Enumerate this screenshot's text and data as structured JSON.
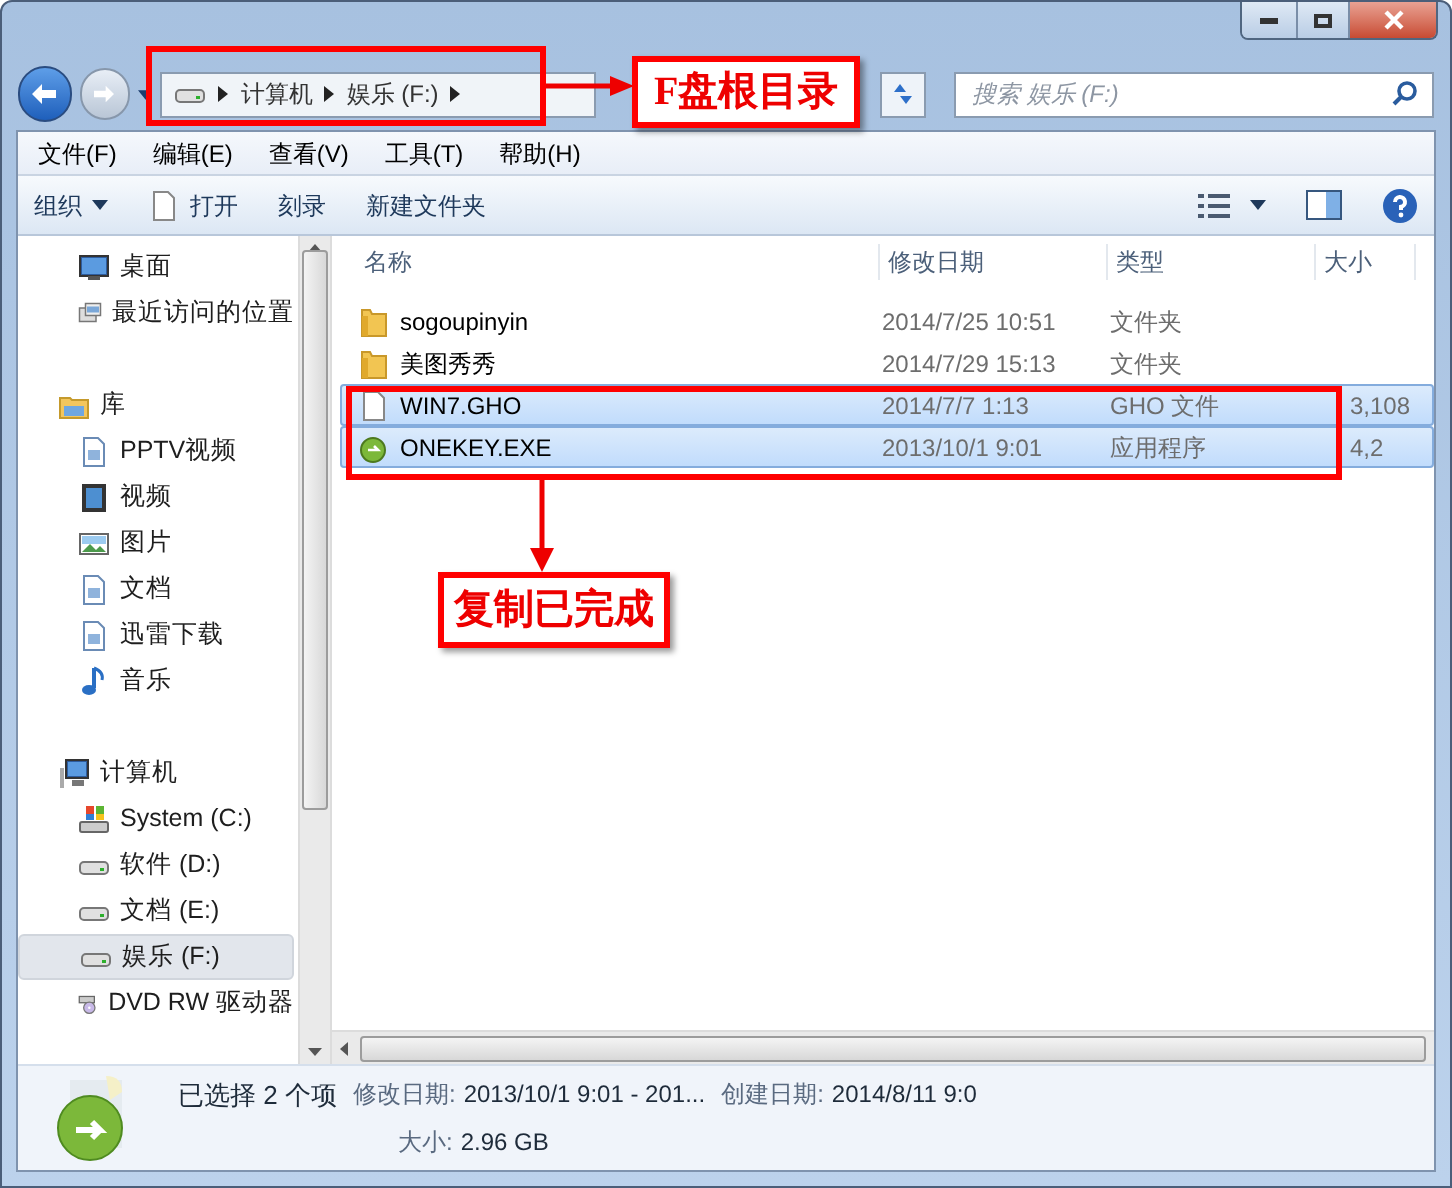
{
  "navigation": {
    "breadcrumb": [
      "计算机",
      "娱乐 (F:)"
    ],
    "search": {
      "placeholder": "搜索 娱乐 (F:)"
    }
  },
  "menu": [
    "文件(F)",
    "编辑(E)",
    "查看(V)",
    "工具(T)",
    "帮助(H)"
  ],
  "toolbar": [
    {
      "label": "组织",
      "kind": "dropdown"
    },
    {
      "label": "打开",
      "kind": "file"
    },
    {
      "label": "刻录",
      "kind": "plain"
    },
    {
      "label": "新建文件夹",
      "kind": "plain"
    }
  ],
  "sidebar": {
    "items": [
      {
        "label": "桌面",
        "kind": "desktop",
        "selected": false
      },
      {
        "label": "最近访问的位置",
        "kind": "recent",
        "selected": false
      },
      {
        "label": "库",
        "kind": "library",
        "selected": false,
        "children": [
          {
            "label": "PPTV视频",
            "kind": "doc",
            "selected": false
          },
          {
            "label": "视频",
            "kind": "video",
            "selected": false
          },
          {
            "label": "图片",
            "kind": "picture",
            "selected": false
          },
          {
            "label": "文档",
            "kind": "doc",
            "selected": false
          },
          {
            "label": "迅雷下载",
            "kind": "doc",
            "selected": false
          },
          {
            "label": "音乐",
            "kind": "music",
            "selected": false
          }
        ]
      },
      {
        "label": "计算机",
        "kind": "computer",
        "selected": false,
        "children": [
          {
            "label": "System (C:)",
            "kind": "system",
            "selected": false
          },
          {
            "label": "软件 (D:)",
            "kind": "drive",
            "selected": false
          },
          {
            "label": "文档 (E:)",
            "kind": "drive",
            "selected": false
          },
          {
            "label": "娱乐 (F:)",
            "kind": "drive",
            "selected": true
          },
          {
            "label": "DVD RW 驱动器",
            "kind": "dvd",
            "selected": false
          }
        ]
      }
    ]
  },
  "table": {
    "columns": [
      "名称",
      "修改日期",
      "类型",
      "大小"
    ],
    "rows": [
      {
        "name": "sogoupinyin",
        "kind": "folder",
        "date": "2014/7/25 10:51",
        "type": "文件夹",
        "selected": false
      },
      {
        "name": "美图秀秀",
        "kind": "folder",
        "date": "2014/7/29 15:13",
        "type": "文件夹",
        "selected": false
      },
      {
        "name": "WIN7.GHO",
        "kind": "file",
        "date": "2014/7/7 1:13",
        "type": "GHO 文件",
        "size": "3,108",
        "selected": true
      },
      {
        "name": "ONEKEY.EXE",
        "kind": "app",
        "date": "2013/10/1 9:01",
        "type": "应用程序",
        "size": "4,2",
        "selected": true
      }
    ]
  },
  "status_bar": {
    "selection": "已选择 2 个项",
    "modified_label": "修改日期:",
    "modified": "2013/10/1 9:01 - 201...",
    "created_label": "创建日期:",
    "created": "2014/8/11 9:0",
    "size_label": "大小:",
    "size": "2.96 GB"
  },
  "annotations": [
    {
      "text": "F盘根目录"
    },
    {
      "text": "复制已完成"
    }
  ]
}
